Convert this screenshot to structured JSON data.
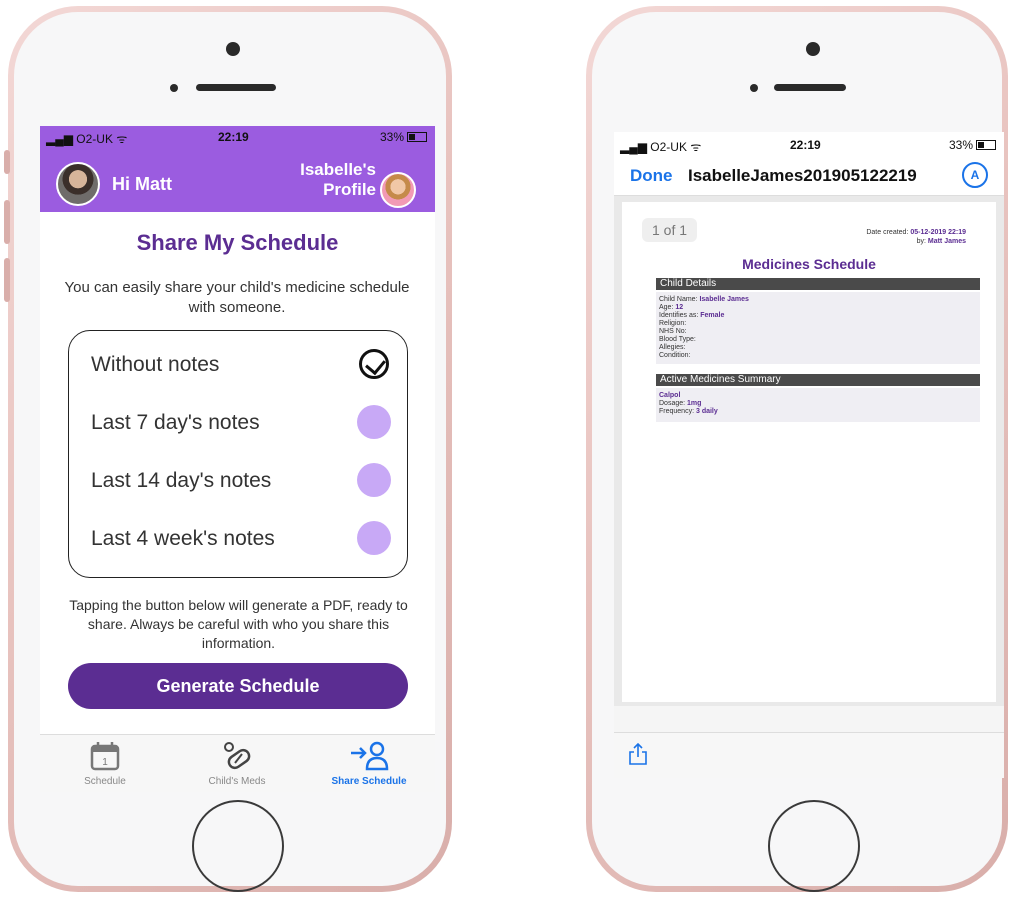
{
  "left": {
    "status": {
      "carrier": "O2-UK",
      "time": "22:19",
      "battery": "33%"
    },
    "header": {
      "greeting": "Hi Matt",
      "profile_line1": "Isabelle's",
      "profile_line2": "Profile"
    },
    "title": "Share My Schedule",
    "intro": "You can easily share your child's medicine schedule with someone.",
    "options": [
      {
        "label": "Without notes",
        "selected": true
      },
      {
        "label": "Last 7 day's notes",
        "selected": false
      },
      {
        "label": "Last 14 day's notes",
        "selected": false
      },
      {
        "label": "Last 4 week's notes",
        "selected": false
      }
    ],
    "note": "Tapping the button below will generate a PDF, ready to share. Always be careful with who you share this information.",
    "generate_label": "Generate Schedule",
    "tabs": [
      {
        "label": "Schedule",
        "icon": "calendar-icon",
        "active": false,
        "cal_day": "1"
      },
      {
        "label": "Child's Meds",
        "icon": "pill-icon",
        "active": false
      },
      {
        "label": "Share Schedule",
        "icon": "share-person-icon",
        "active": true
      }
    ],
    "colors": {
      "header": "#9b5ce0",
      "accent": "#5b2d92",
      "radio": "#c8a9f6",
      "tab_active": "#1a73e8"
    }
  },
  "right": {
    "status": {
      "carrier": "O2-UK",
      "time": "22:19",
      "battery": "33%"
    },
    "nav": {
      "done_label": "Done",
      "document_name": "IsabelleJames201905122219",
      "markup_glyph": "A"
    },
    "pager": "1 of 1",
    "created": {
      "label": "Date created:",
      "value": "05-12-2019 22:19",
      "by_label": "by:",
      "by_value": "Matt James"
    },
    "doc_title": "Medicines Schedule",
    "child_details": {
      "heading": "Child Details",
      "rows": [
        {
          "label": "Child Name:",
          "value": "Isabelle James"
        },
        {
          "label": "Age:",
          "value": "12"
        },
        {
          "label": "Identifies as:",
          "value": "Female"
        },
        {
          "label": "Religion:",
          "value": ""
        },
        {
          "label": "NHS No:",
          "value": ""
        },
        {
          "label": "Blood Type:",
          "value": ""
        },
        {
          "label": "Allegies:",
          "value": ""
        },
        {
          "label": "Condition:",
          "value": ""
        }
      ]
    },
    "medicines": {
      "heading": "Active Medicines Summary",
      "name": "Calpol",
      "rows": [
        {
          "label": "Dosage:",
          "value": "1mg"
        },
        {
          "label": "Frequency:",
          "value": "3 daily"
        }
      ]
    }
  }
}
